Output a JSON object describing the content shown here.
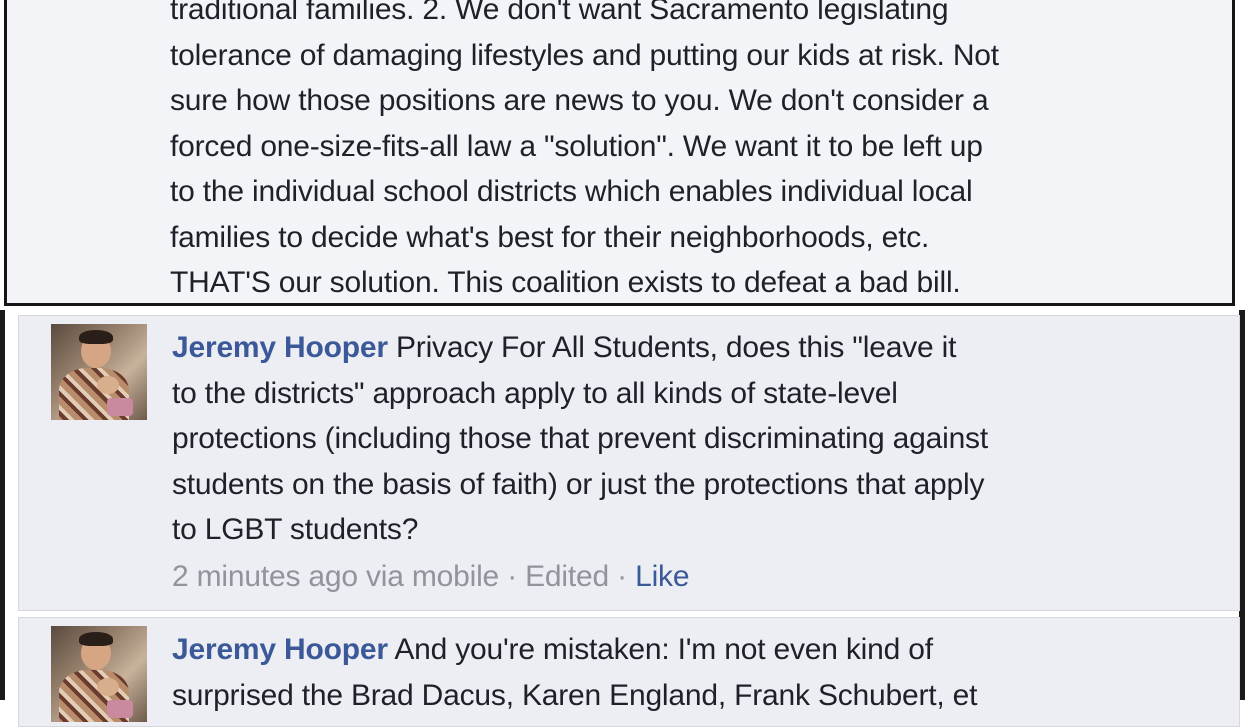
{
  "comments": [
    {
      "lines": [
        "traditional families. 2. We don't want Sacramento legislating",
        "tolerance of damaging lifestyles and putting our kids at risk. Not",
        "sure how those positions are news to you. We don't consider a",
        "forced one-size-fits-all law a \"solution\". We want it to be left up",
        "to the individual school districts which enables individual local",
        "families to decide what's best for their neighborhoods, etc.",
        "THAT'S our solution. This coalition exists to defeat a bad bill."
      ]
    },
    {
      "author": "Jeremy Hooper",
      "first_line": "Privacy For All Students, does this \"leave it",
      "lines": [
        "to the districts\" approach apply to all kinds of state-level",
        "protections (including those that prevent discriminating against",
        "students on the basis of faith) or just the protections that apply",
        "to LGBT students?"
      ],
      "time": "2 minutes ago via mobile",
      "edited": "Edited",
      "like": "Like",
      "separator": "·"
    },
    {
      "author": "Jeremy Hooper",
      "first_line": "And you're mistaken: I'm not even kind of",
      "lines": [
        "surprised the Brad Dacus, Karen England, Frank Schubert, et"
      ]
    }
  ]
}
